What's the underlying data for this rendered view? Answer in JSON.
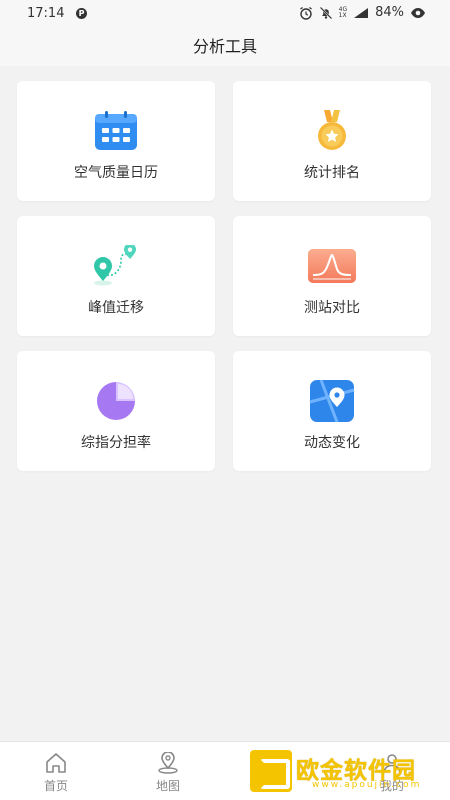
{
  "status_bar": {
    "time": "17:14",
    "app_badge": "P",
    "signal_mini_top": "4G",
    "signal_mini_bottom": "1X",
    "battery": "84%"
  },
  "header": {
    "title": "分析工具"
  },
  "tools": [
    {
      "label": "空气质量日历",
      "icon": "calendar-icon"
    },
    {
      "label": "统计排名",
      "icon": "medal-icon"
    },
    {
      "label": "峰值迁移",
      "icon": "map-pins-icon"
    },
    {
      "label": "测站对比",
      "icon": "chart-peak-icon"
    },
    {
      "label": "综指分担率",
      "icon": "pie-chart-icon"
    },
    {
      "label": "动态变化",
      "icon": "map-location-icon"
    }
  ],
  "tab_bar": {
    "items": [
      {
        "label": "首页",
        "icon": "home-icon"
      },
      {
        "label": "地图",
        "icon": "map-pin-icon"
      },
      {
        "label": "",
        "icon": "analysis-icon"
      },
      {
        "label": "我的",
        "icon": "user-icon"
      }
    ]
  },
  "watermark": {
    "text": "欧金软件园",
    "sub": "www.apoujin.com"
  },
  "colors": {
    "tab_inactive": "#888888",
    "card_bg": "#ffffff",
    "page_bg": "#f2f2f2"
  }
}
